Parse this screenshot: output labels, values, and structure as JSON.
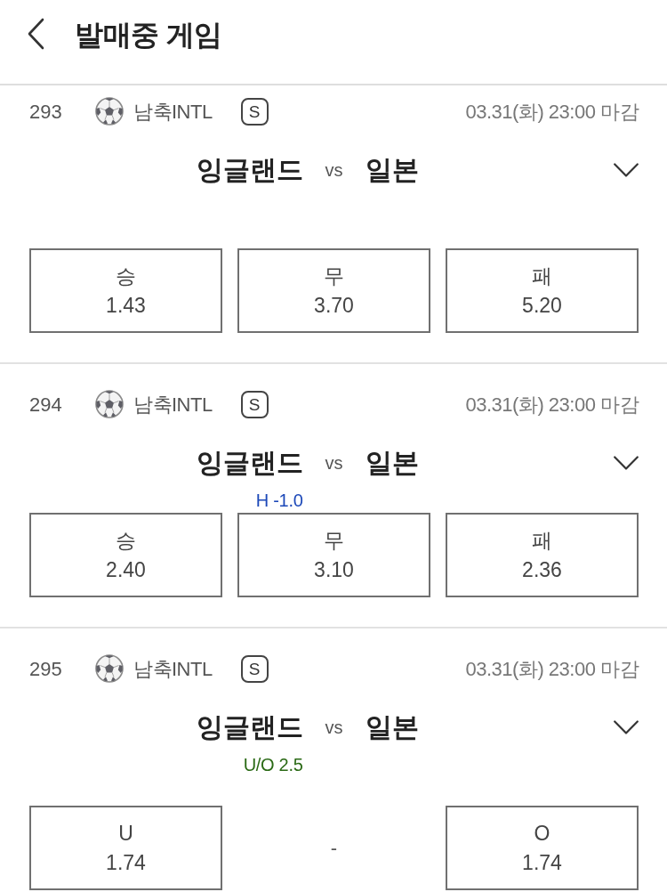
{
  "header": {
    "title": "발매중 게임"
  },
  "games": [
    {
      "number": "293",
      "league": "남축INTL",
      "type_badge": "S",
      "close_time": "03.31(화) 23:00 마감",
      "home": "잉글랜드",
      "vs": "vs",
      "away": "일본",
      "expanded": false,
      "options": [
        {
          "kind": "odds",
          "label": "승",
          "odds": "1.43",
          "selected": false
        },
        {
          "kind": "odds",
          "label": "무",
          "odds": "3.70",
          "selected": false
        },
        {
          "kind": "odds",
          "label": "패",
          "odds": "5.20",
          "selected": false
        }
      ]
    },
    {
      "number": "294",
      "league": "남축INTL",
      "type_badge": "S",
      "close_time": "03.31(화) 23:00 마감",
      "home": "잉글랜드",
      "vs": "vs",
      "away": "일본",
      "expanded": false,
      "line": {
        "kind": "handicap",
        "text": "H -1.0"
      },
      "options": [
        {
          "kind": "odds",
          "label": "승",
          "odds": "2.40",
          "selected": false
        },
        {
          "kind": "odds",
          "label": "무",
          "odds": "3.10",
          "selected": false
        },
        {
          "kind": "odds",
          "label": "패",
          "odds": "2.36",
          "selected": false
        }
      ]
    },
    {
      "number": "295",
      "league": "남축INTL",
      "type_badge": "S",
      "close_time": "03.31(화) 23:00 마감",
      "home": "잉글랜드",
      "vs": "vs",
      "away": "일본",
      "expanded": false,
      "line": {
        "kind": "under_over",
        "text": "U/O 2.5"
      },
      "options": [
        {
          "kind": "odds",
          "label": "U",
          "odds": "1.74",
          "selected": false
        },
        {
          "kind": "blank",
          "text": "-"
        },
        {
          "kind": "odds",
          "label": "O",
          "odds": "1.74",
          "selected": false
        }
      ]
    }
  ]
}
